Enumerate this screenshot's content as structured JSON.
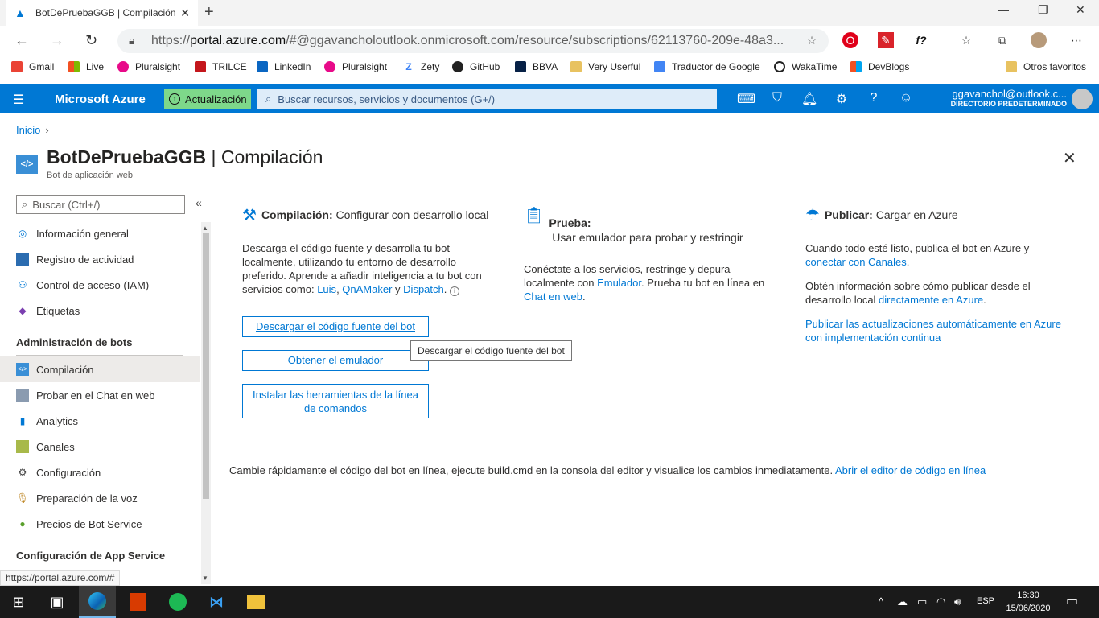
{
  "browser": {
    "tab_title": "BotDePruebaGGB | Compilación",
    "url_prefix": "https://",
    "url_host": "portal.azure.com",
    "url_rest": "/#@ggavancholoutlook.onmicrosoft.com/resource/subscriptions/62113760-209e-48a3...",
    "bookmarks": [
      "Gmail",
      "Live",
      "Pluralsight",
      "TRILCE",
      "LinkedIn",
      "Pluralsight",
      "Zety",
      "GitHub",
      "BBVA",
      "Very Userful",
      "Traductor de Google",
      "WakaTime",
      "DevBlogs"
    ],
    "other_favorites": "Otros favoritos",
    "status_url": "https://portal.azure.com/#"
  },
  "azure": {
    "brand": "Microsoft Azure",
    "update_label": "Actualización",
    "search_placeholder": "Buscar recursos, servicios y documentos (G+/)",
    "account_email": "ggavanchol@outlook.c...",
    "account_directory": "DIRECTORIO PREDETERMINADO"
  },
  "page": {
    "breadcrumb": "Inicio",
    "title_resource": "BotDePruebaGGB",
    "title_sep": " | ",
    "title_blade": "Compilación",
    "subtitle": "Bot de aplicación web"
  },
  "sidebar": {
    "search_placeholder": "Buscar (Ctrl+/)",
    "items_top": [
      {
        "label": "Información general"
      },
      {
        "label": "Registro de actividad"
      },
      {
        "label": "Control de acceso (IAM)"
      },
      {
        "label": "Etiquetas"
      }
    ],
    "group_bots": "Administración de bots",
    "items_bots": [
      {
        "label": "Compilación"
      },
      {
        "label": "Probar en el Chat en web"
      },
      {
        "label": "Analytics"
      },
      {
        "label": "Canales"
      },
      {
        "label": "Configuración"
      },
      {
        "label": "Preparación de la voz"
      },
      {
        "label": "Precios de Bot Service"
      }
    ],
    "group_app": "Configuración de App Service"
  },
  "build": {
    "head_bold": "Compilación:",
    "head_rest": " Configurar con desarrollo local",
    "desc": "Descarga el código fuente y desarrolla tu bot localmente, utilizando tu entorno de desarrollo preferido. Aprende a añadir inteligencia a tu bot con servicios como: ",
    "link_luis": "Luis",
    "comma": ", ",
    "link_qna": "QnAMaker",
    "and": " y ",
    "link_dispatch": "Dispatch",
    "period": ".",
    "btn_download": "Descargar el código fuente del bot",
    "btn_emulator": "Obtener el emulador",
    "btn_cli": "Instalar las herramientas de la línea de comandos",
    "tooltip": "Descargar el código fuente del bot"
  },
  "test": {
    "head_bold": "Prueba:",
    "head_rest": " Usar emulador para probar y restringir",
    "desc1": "Conéctate a los servicios, restringe y depura localmente con ",
    "link_emulator": "Emulador",
    "desc2": ". Prueba tu bot en línea en ",
    "link_chat": "Chat en web",
    "desc3": "."
  },
  "publish": {
    "head_bold": "Publicar:",
    "head_rest": " Cargar en Azure",
    "p1": "Cuando todo esté listo, publica el bot en Azure y ",
    "p1_link": "conectar con Canales",
    "p1_end": ".",
    "p2": "Obtén información sobre cómo publicar desde el desarrollo local ",
    "p2_link": "directamente en Azure",
    "p2_end": ".",
    "p3_link": "Publicar las actualizaciones automáticamente en Azure con implementación continua"
  },
  "footer": {
    "text": "Cambie rápidamente el código del bot en línea, ejecute build.cmd en la consola del editor y visualice los cambios inmediatamente. ",
    "link": "Abrir el editor de código en línea"
  },
  "taskbar": {
    "lang": "ESP",
    "time": "16:30",
    "date": "15/06/2020"
  },
  "colors": {
    "azure_blue": "#0078d4",
    "update_green": "#7ed88a"
  }
}
